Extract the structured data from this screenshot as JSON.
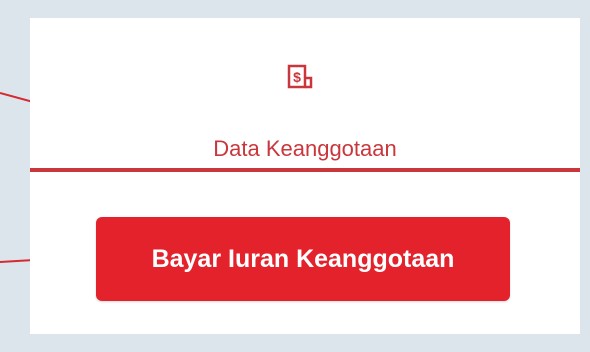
{
  "tab": {
    "label": "Data Keanggotaan",
    "icon": "receipt-dollar-icon",
    "accent_color": "#c9373c"
  },
  "action": {
    "pay_label": "Bayar Iuran Keanggotaan",
    "button_color": "#e3222b"
  },
  "annotations": {
    "arrow_color": "#d42a32"
  }
}
